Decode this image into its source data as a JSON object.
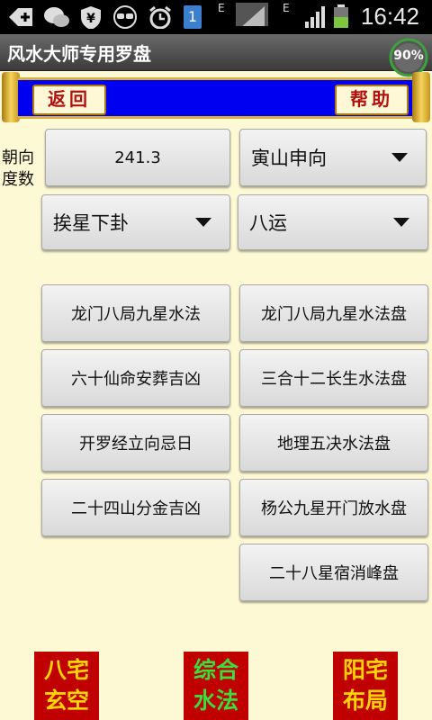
{
  "status_bar": {
    "time": "16:42",
    "network_label": "E",
    "network_label_2": "E",
    "notification_count": "1",
    "icons": [
      "add-icon",
      "wechat-icon",
      "shield-icon",
      "glasses-icon",
      "alarm-icon",
      "notification-badge-icon",
      "signal-icon",
      "battery-icon"
    ]
  },
  "app": {
    "title": "风水大师专用罗盘",
    "progress_percent": "90%",
    "accent_color": "#0000f0",
    "banner_text_color": "#b01010"
  },
  "banner": {
    "back_label": "返回",
    "help_label": "帮助"
  },
  "controls": {
    "direction_label_1": "朝向",
    "direction_label_2": "度数",
    "degree_value": "241.3",
    "mountain_selected": "寅山申向",
    "star_method_selected": "挨星下卦",
    "era_selected": "八运"
  },
  "buttons": {
    "left": [
      "龙门八局九星水法",
      "六十仙命安葬吉凶",
      "开罗经立向忌日",
      "二十四山分金吉凶"
    ],
    "right": [
      "龙门八局九星水法盘",
      "三合十二长生水法盘",
      "地理五决水法盘",
      "杨公九星开门放水盘",
      "二十八星宿消峰盘"
    ]
  },
  "bottom": {
    "seal_1": [
      "八宅",
      "玄空"
    ],
    "seal_2": [
      "综合",
      "水法"
    ],
    "seal_3": [
      "阳宅",
      "布局"
    ],
    "seal_color": "#c00000",
    "seal_1_text_color": "#ffd400",
    "seal_2_text_color": "#3adf3a",
    "seal_3_text_color": "#ffd400"
  }
}
